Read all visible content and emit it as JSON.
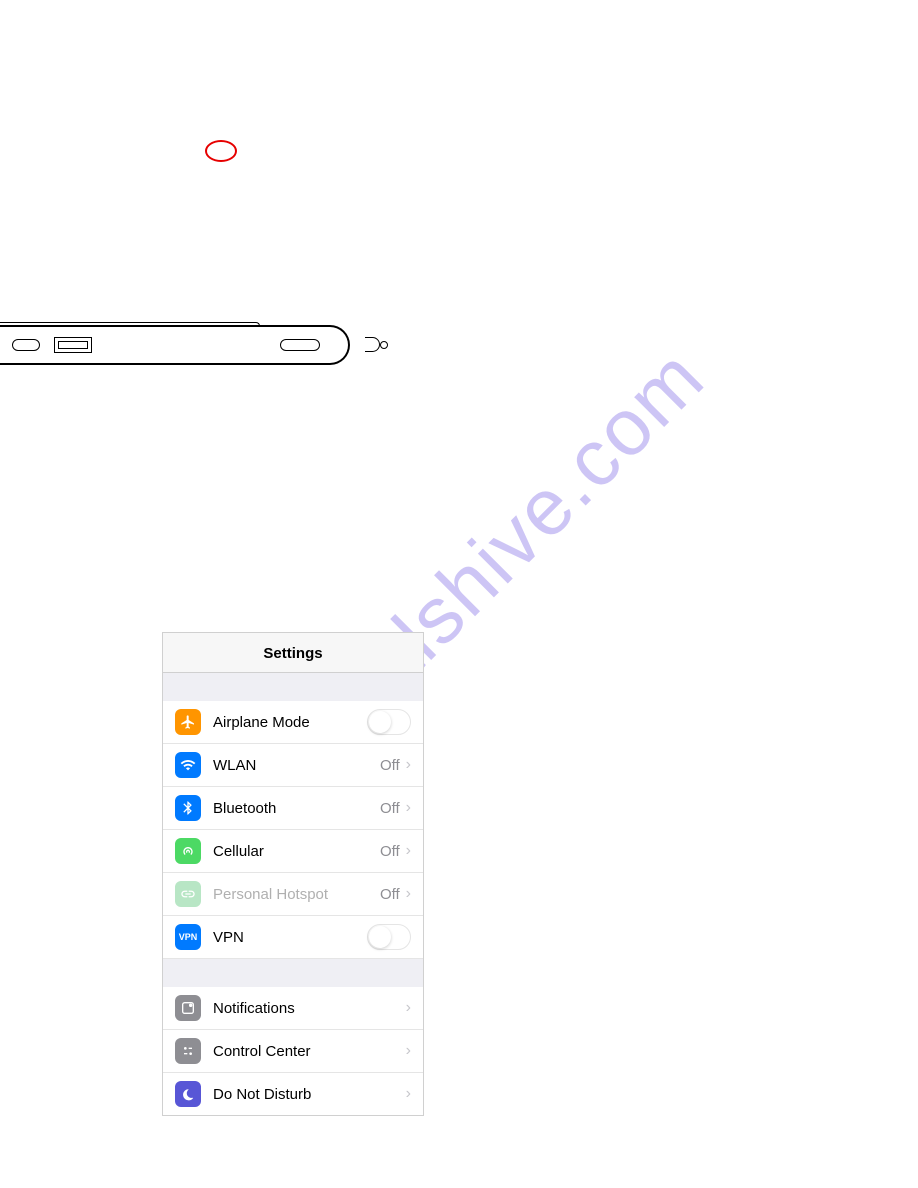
{
  "watermark": "manualshive.com",
  "settings": {
    "title": "Settings",
    "group1": [
      {
        "label": "Airplane Mode",
        "type": "toggle",
        "icon": "airplane"
      },
      {
        "label": "WLAN",
        "value": "Off",
        "type": "nav",
        "icon": "wlan"
      },
      {
        "label": "Bluetooth",
        "value": "Off",
        "type": "nav",
        "icon": "bluetooth"
      },
      {
        "label": "Cellular",
        "value": "Off",
        "type": "nav",
        "icon": "cellular"
      },
      {
        "label": "Personal Hotspot",
        "value": "Off",
        "type": "nav",
        "icon": "hotspot",
        "disabled": true
      },
      {
        "label": "VPN",
        "type": "toggle",
        "icon": "vpn"
      }
    ],
    "group2": [
      {
        "label": "Notifications",
        "type": "nav",
        "icon": "notifications"
      },
      {
        "label": "Control Center",
        "type": "nav",
        "icon": "control"
      },
      {
        "label": "Do Not Disturb",
        "type": "nav",
        "icon": "dnd"
      }
    ]
  }
}
